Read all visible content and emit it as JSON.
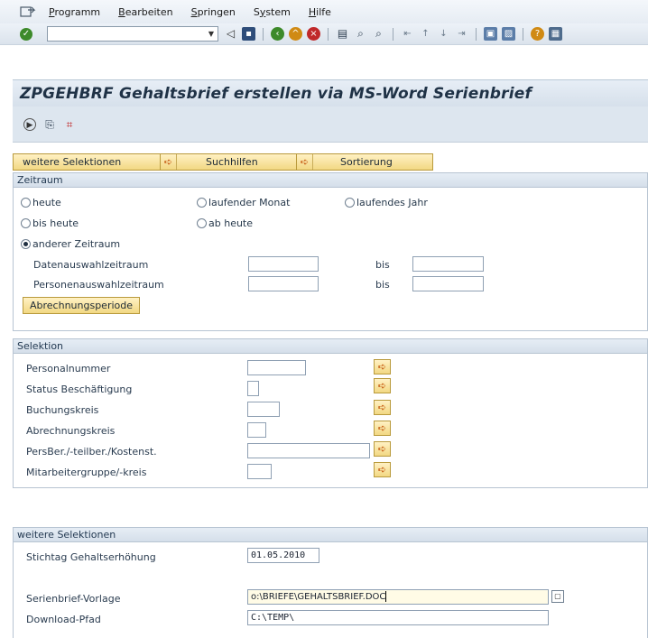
{
  "menubar": {
    "items": [
      {
        "ul": "P",
        "rest": "rogramm"
      },
      {
        "ul": "B",
        "rest": "earbeiten"
      },
      {
        "ul": "S",
        "rest": "pringen"
      },
      {
        "pre": "S",
        "ul": "y",
        "rest": "stem"
      },
      {
        "ul": "H",
        "rest": "ilfe"
      }
    ]
  },
  "toolbar": {
    "command_value": "",
    "icons": [
      "enter-icon",
      "back-icon",
      "save-icon",
      "back-arrow-icon",
      "exit-icon",
      "cancel-icon",
      "print-icon",
      "find-icon",
      "find-next-icon",
      "first-page-icon",
      "previous-page-icon",
      "next-page-icon",
      "last-page-icon",
      "new-session-icon",
      "shortcut-icon",
      "help-icon",
      "layout-icon"
    ]
  },
  "title": "ZPGEHBRF Gehaltsbrief erstellen via MS-Word Serienbrief",
  "tabs": {
    "weitere": "weitere Selektionen",
    "suchhilfen": "Suchhilfen",
    "sortierung": "Sortierung"
  },
  "zeitraum": {
    "title": "Zeitraum",
    "opt_heute": "heute",
    "opt_laufender_monat": "laufender Monat",
    "opt_laufendes_jahr": "laufendes Jahr",
    "opt_bis_heute": "bis heute",
    "opt_ab_heute": "ab heute",
    "opt_anderer": "anderer Zeitraum",
    "selected": "anderer Zeitraum",
    "daten_label": "Datenauswahlzeitraum",
    "personen_label": "Personenauswahlzeitraum",
    "bis": "bis",
    "daten_from": "",
    "daten_to": "",
    "personen_from": "",
    "personen_to": "",
    "abrechnung_button": "Abrechnungsperiode"
  },
  "selektion": {
    "title": "Selektion",
    "fields": [
      {
        "label": "Personalnummer",
        "value": ""
      },
      {
        "label": "Status Beschäftigung",
        "value": ""
      },
      {
        "label": "Buchungskreis",
        "value": ""
      },
      {
        "label": "Abrechnungskreis",
        "value": ""
      },
      {
        "label": "PersBer./-teilber./Kostenst.",
        "value": ""
      },
      {
        "label": "Mitarbeitergruppe/-kreis",
        "value": ""
      }
    ]
  },
  "weitere": {
    "title": "weitere Selektionen",
    "stichtag_label": "Stichtag Gehaltserhöhung",
    "stichtag_value": "01.05.2010",
    "vorlage_label": "Serienbrief-Vorlage",
    "vorlage_value": "o:\\BRIEFE\\GEHALTSBRIEF.DOC",
    "pfad_label": "Download-Pfad",
    "pfad_value": "C:\\TEMP\\"
  },
  "colors": {
    "accent": "#f2d883",
    "title_bg": "#d6e0eb",
    "brand": "#1f3246"
  }
}
